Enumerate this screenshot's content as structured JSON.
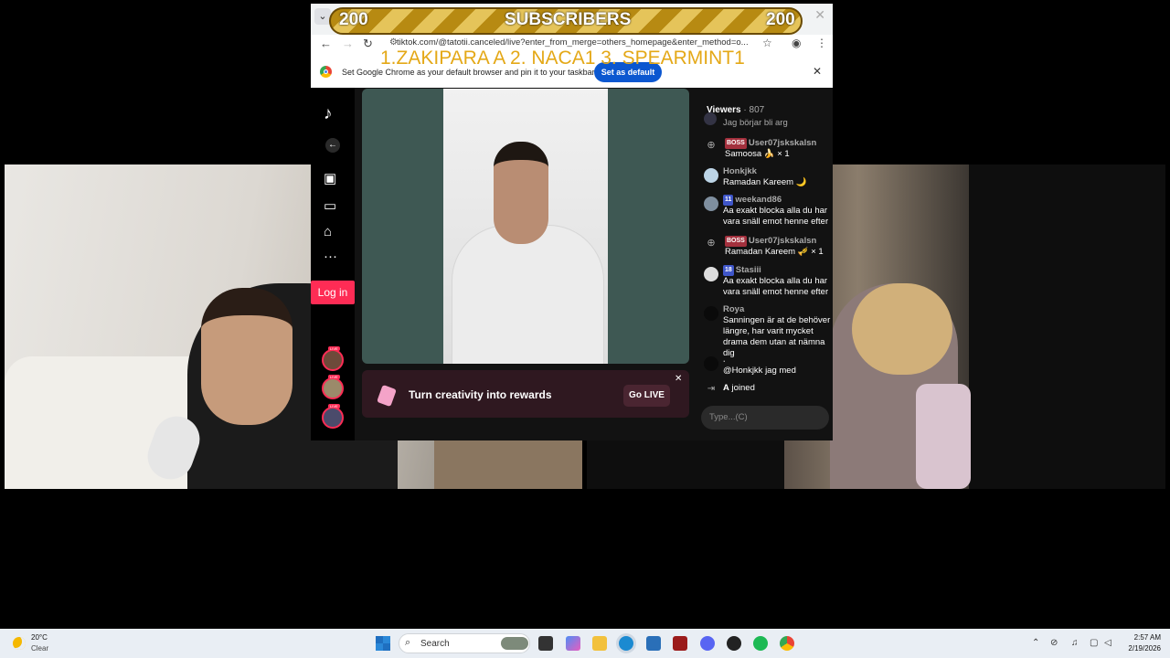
{
  "overlay": {
    "sub_count_left": "200",
    "sub_title": "SUBSCRIBERS",
    "sub_count_right": "200",
    "top_list": "1.ZAKIPARA A 2. NACA1  3.  SPEARMINT1"
  },
  "browser": {
    "url": "tiktok.com/@tatotii.canceled/live?enter_from_merge=others_homepage&enter_method=o...",
    "default_prompt": "Set Google Chrome as your default browser and pin it to your taskbar",
    "set_default_label": "Set as default",
    "close_symbol": "✕"
  },
  "tiktok": {
    "login_label": "Log in",
    "live_badge": "LIVE",
    "promo_text": "Turn creativity into rewards",
    "go_live_label": "Go LIVE",
    "viewers_label": "Viewers",
    "viewers_count": "· 807",
    "chat_placeholder": "Type...(C)",
    "messages": [
      {
        "user": "",
        "text": "Jag börjar bli arg"
      },
      {
        "badge": "BOSS",
        "user": "User07jskskalsn",
        "text": "Samoosa 🍌 × 1"
      },
      {
        "user": "Honkjkk",
        "text": "Ramadan Kareem 🌙"
      },
      {
        "badge": "11",
        "user": "weekand86",
        "text": "Aa exakt blocka alla du har vara snäll emot henne efter"
      },
      {
        "badge": "BOSS",
        "user": "User07jskskalsn",
        "text": "Ramadan Kareem 🎺 × 1"
      },
      {
        "badge": "18",
        "user": "Stasiii",
        "text": "Aa exakt blocka alla du har vara snäll emot henne efter"
      },
      {
        "user": "Roya",
        "text": "Sanningen är at de behöver längre, har varit mycket drama dem utan at nämna dig"
      },
      {
        "user": ".",
        "text": "@Honkjkk jag med"
      },
      {
        "user": "A",
        "text": "joined"
      }
    ]
  },
  "taskbar": {
    "temperature": "20°C",
    "weather": "Clear",
    "search_label": "Search",
    "time": "2:57 AM",
    "date": "2/19/2026"
  }
}
